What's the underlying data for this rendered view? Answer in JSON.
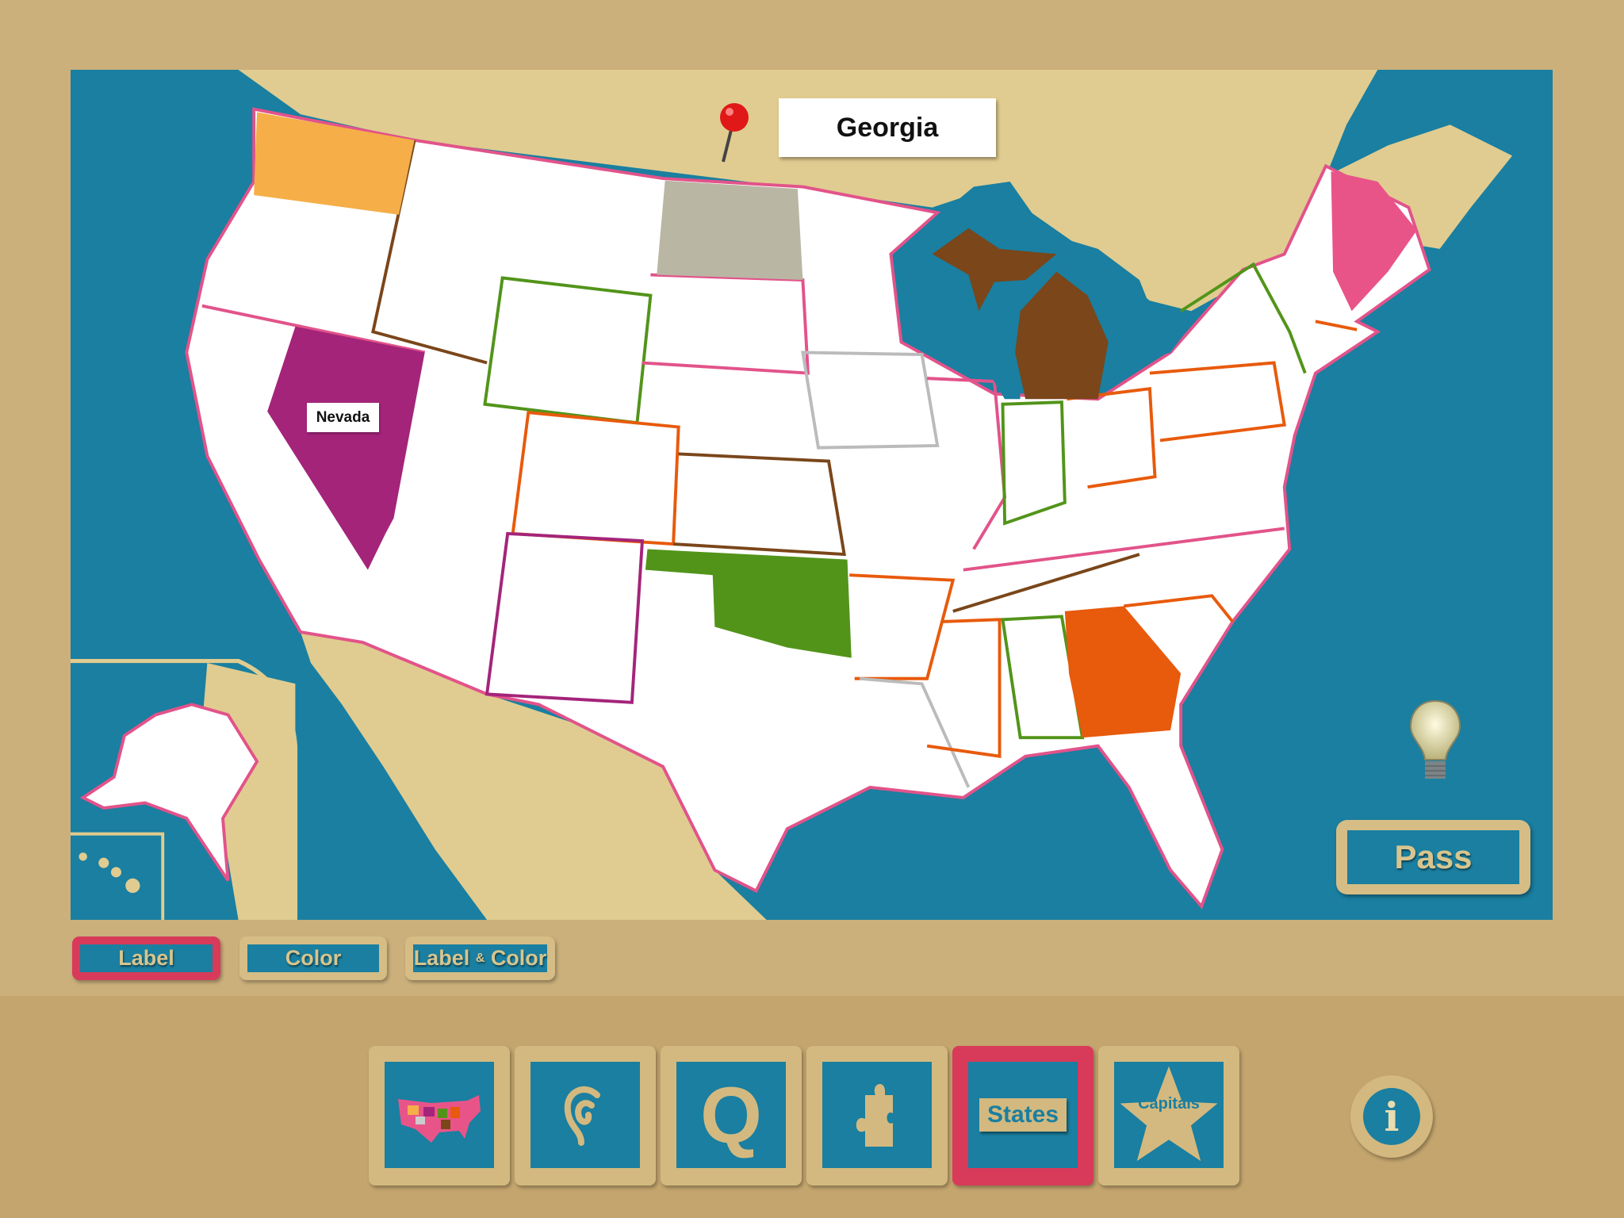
{
  "prompt": {
    "target_state": "Georgia"
  },
  "placed_labels": [
    {
      "state": "Nevada"
    }
  ],
  "colors": {
    "ocean": "#1a7fa0",
    "land": "#e0cc90",
    "frame": "#cbb07c",
    "active_highlight": "#d83a5a",
    "washington": "#f5ae48",
    "nevada": "#a4247a",
    "north_dakota": "#b9b6a4",
    "oklahoma": "#52941a",
    "georgia": "#e85a0c",
    "maine": "#e95488",
    "michigan": "#7a461a"
  },
  "actions": {
    "pass_label": "Pass",
    "hint_icon": "lightbulb-icon"
  },
  "modes": [
    {
      "label": "Label",
      "active": true
    },
    {
      "label": "Color",
      "active": false
    },
    {
      "label_main": "Label",
      "label_amp": "&",
      "label_end": "Color",
      "active": false
    }
  ],
  "nav": [
    {
      "icon": "us-map-icon",
      "active": false
    },
    {
      "icon": "ear-icon",
      "active": false
    },
    {
      "icon": "quiz-q-icon",
      "active": false
    },
    {
      "icon": "puzzle-icon",
      "active": false
    },
    {
      "label": "States",
      "active": true
    },
    {
      "label": "Capitals",
      "icon": "star-icon",
      "active": false
    }
  ],
  "info": {
    "icon": "info-icon",
    "glyph": "i"
  }
}
